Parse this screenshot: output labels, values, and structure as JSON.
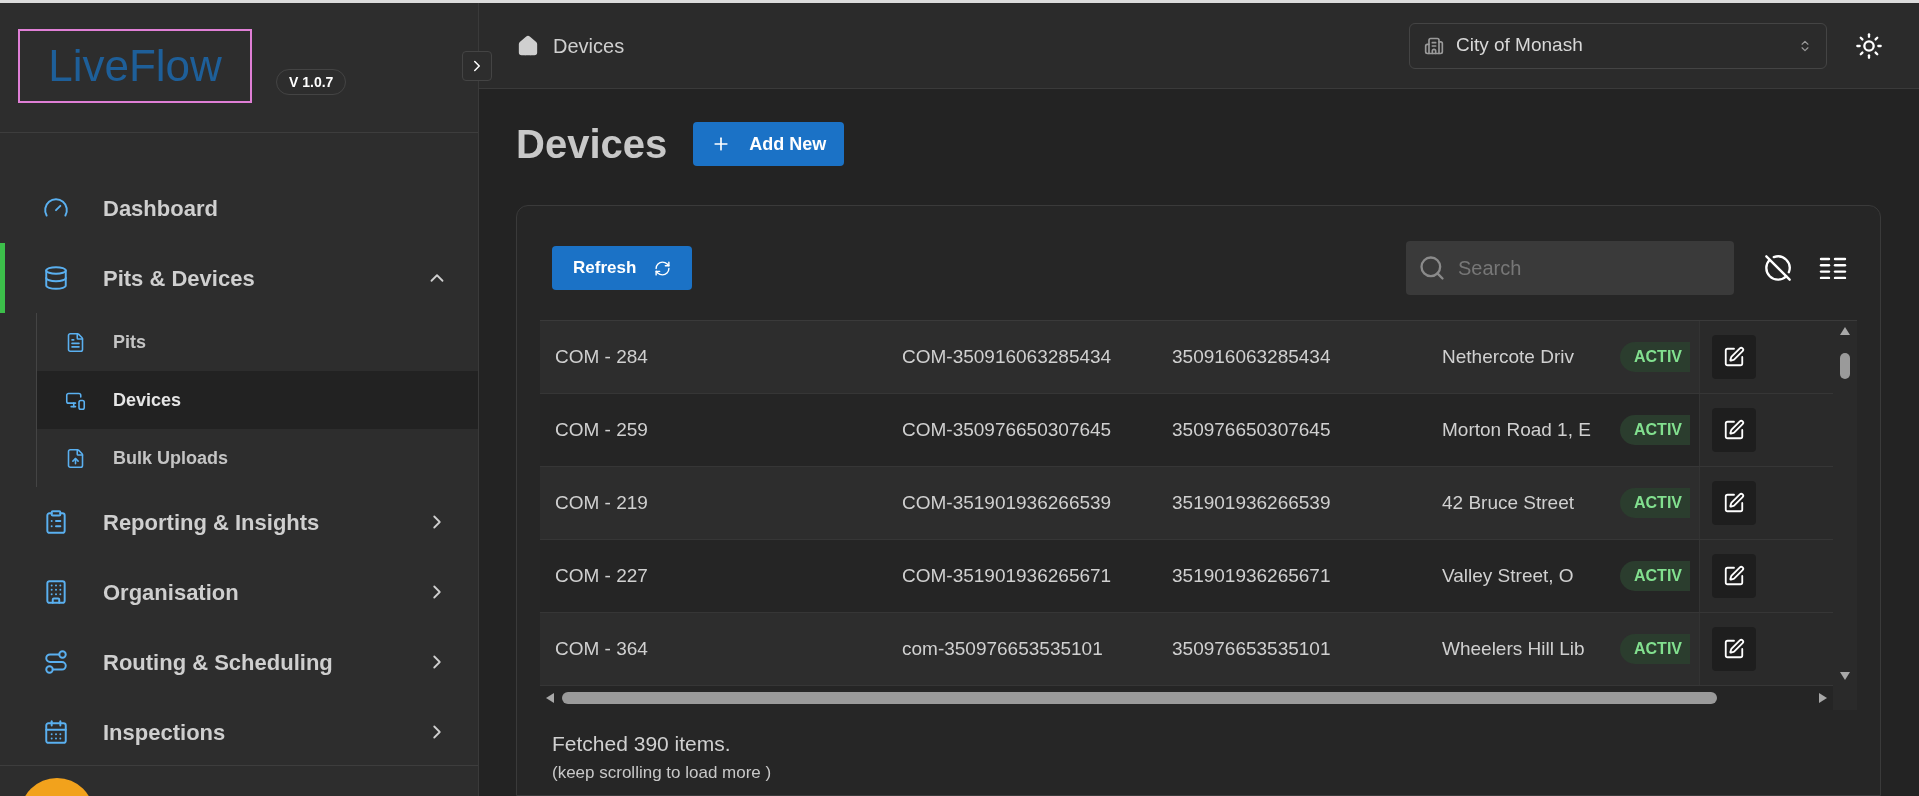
{
  "brand": {
    "logo": "LiveFlow",
    "version": "V 1.0.7"
  },
  "sidebar": {
    "items": [
      {
        "kind": "link",
        "label": "Dashboard",
        "active": false
      },
      {
        "kind": "group",
        "label": "Pits & Devices",
        "active": true,
        "expanded": true,
        "children": [
          {
            "label": "Pits",
            "selected": false
          },
          {
            "label": "Devices",
            "selected": true
          },
          {
            "label": "Bulk Uploads",
            "selected": false
          }
        ]
      },
      {
        "kind": "group",
        "label": "Reporting & Insights",
        "active": false,
        "expanded": false
      },
      {
        "kind": "group",
        "label": "Organisation",
        "active": false,
        "expanded": false
      },
      {
        "kind": "group",
        "label": "Routing & Scheduling",
        "active": false,
        "expanded": false
      },
      {
        "kind": "group",
        "label": "Inspections",
        "active": false,
        "expanded": false
      }
    ]
  },
  "header": {
    "breadcrumb": "Devices",
    "organisation": "City of Monash"
  },
  "page": {
    "title": "Devices",
    "add_button": "Add New"
  },
  "toolbar": {
    "refresh": "Refresh",
    "search_placeholder": "Search"
  },
  "table": {
    "rows": [
      {
        "cells": [
          "COM - 284",
          "COM-350916063285434",
          "350916063285434",
          "Nethercote Driv"
        ],
        "status": "ACTIV"
      },
      {
        "cells": [
          "COM - 259",
          "COM-350976650307645",
          "350976650307645",
          "Morton Road 1, E"
        ],
        "status": "ACTIV"
      },
      {
        "cells": [
          "COM - 219",
          "COM-351901936266539",
          "351901936266539",
          "42 Bruce Street"
        ],
        "status": "ACTIV"
      },
      {
        "cells": [
          "COM - 227",
          "COM-351901936265671",
          "351901936265671",
          "Valley Street, O"
        ],
        "status": "ACTIV"
      },
      {
        "cells": [
          "COM - 364",
          "com-350976653535101",
          "350976653535101",
          "Wheelers Hill Lib"
        ],
        "status": "ACTIV"
      }
    ]
  },
  "footer": {
    "count": "Fetched 390 items.",
    "hint": "(keep scrolling to load more )"
  }
}
